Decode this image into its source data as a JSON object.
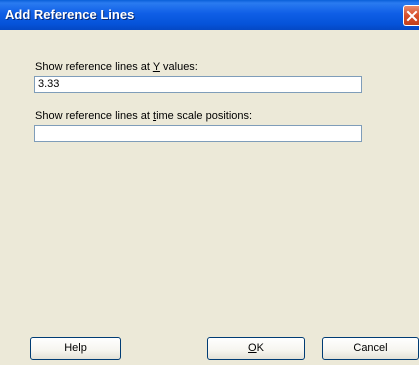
{
  "window": {
    "title": "Add Reference Lines"
  },
  "fields": {
    "y_values": {
      "label_pre": "Show reference lines at ",
      "label_accel": "Y",
      "label_post": " values:",
      "value": "3.33"
    },
    "time_positions": {
      "label_pre": "Show reference lines at ",
      "label_accel": "t",
      "label_post": "ime scale positions:",
      "value": ""
    }
  },
  "buttons": {
    "help": "Help",
    "ok_accel": "O",
    "ok_rest": "K",
    "cancel": "Cancel"
  },
  "icons": {
    "close": "close-icon"
  },
  "colors": {
    "titlebar": "#0553d9",
    "dialog_bg": "#ece9d8",
    "close_button": "#d8502b",
    "input_border": "#7f9db9"
  }
}
